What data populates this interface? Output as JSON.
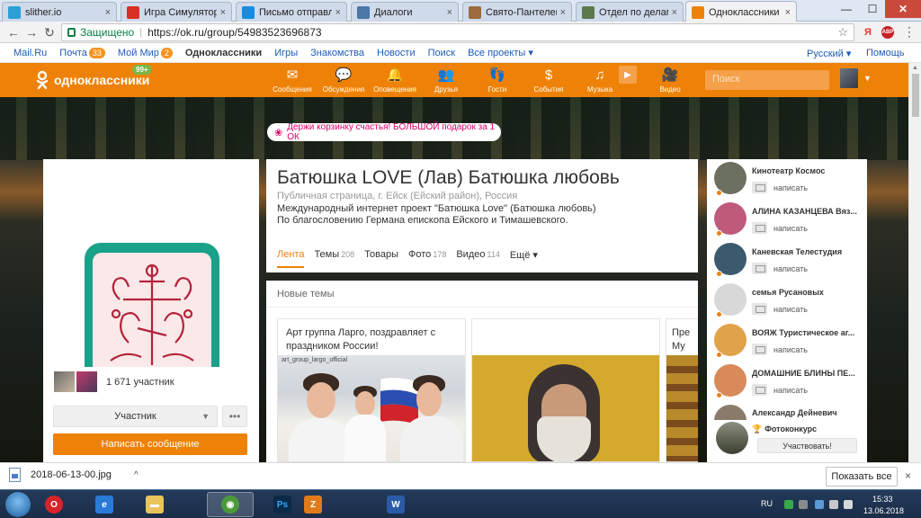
{
  "browser": {
    "tabs": [
      {
        "label": "slither.io",
        "icon": "slither-icon",
        "color": "#2b9fd6"
      },
      {
        "label": "Игра Симулятор",
        "icon": "chrome-icon",
        "color": "#d93025"
      },
      {
        "label": "Письмо отправлено",
        "icon": "mail-icon",
        "color": "#168de2"
      },
      {
        "label": "Диалоги",
        "icon": "vk-icon",
        "color": "#4a76a8"
      },
      {
        "label": "Свято-Пантелеимон",
        "icon": "page-icon",
        "color": "#9c6b3f"
      },
      {
        "label": "Отдел по делам мо",
        "icon": "page-icon",
        "color": "#5a7a4a"
      },
      {
        "label": "Одноклассники",
        "icon": "ok-icon",
        "color": "#ee8208"
      }
    ],
    "tab_close": "×",
    "win_min": "—",
    "win_max": "☐",
    "win_close": "✕",
    "back": "←",
    "forward": "→",
    "reload": "↻",
    "secure_label": "Защищено",
    "url_sep": "|",
    "url": "https://ok.ru/group/54983523696873",
    "star": "☆",
    "ext_yandex": "Я",
    "ext_abp": "ABP",
    "menu": "⋮"
  },
  "mailru": {
    "links": [
      {
        "label": "Mail.Ru"
      },
      {
        "label": "Почта",
        "badge": "33"
      },
      {
        "label": "Мой Мир",
        "badge": "2"
      },
      {
        "label": "Одноклассники",
        "bold": true
      },
      {
        "label": "Игры"
      },
      {
        "label": "Знакомства"
      },
      {
        "label": "Новости"
      },
      {
        "label": "Поиск"
      },
      {
        "label": "Все проекты ▾"
      }
    ],
    "lang": "Русский ▾",
    "help": "Помощь"
  },
  "ok": {
    "logo_text": "одноклассники",
    "badge": "99+",
    "nav": [
      {
        "label": "Сообщения",
        "glyph": "✉"
      },
      {
        "label": "Обсуждения",
        "glyph": "💬"
      },
      {
        "label": "Оповещения",
        "glyph": "🔔"
      },
      {
        "label": "Друзья",
        "glyph": "👥"
      },
      {
        "label": "Гости",
        "glyph": "👣"
      },
      {
        "label": "События",
        "glyph": "$"
      },
      {
        "label": "Музыка",
        "glyph": "♫"
      },
      {
        "label": "",
        "glyph": "▶"
      },
      {
        "label": "Видео",
        "glyph": "🎥"
      }
    ],
    "search_placeholder": "Поиск",
    "avatar_caret": "▼"
  },
  "promo": {
    "icon": "❀",
    "text": "Держи корзинку счастья! БОЛЬШОЙ подарок за 1 ОК"
  },
  "group": {
    "title": "Батюшка LOVE (Лав) Батюшка любовь",
    "subtitle": "Публичная страница, г. Ейск (Ейский район), Россия",
    "desc1": "Международный интернет проект \"Батюшка Love\" (Батюшка любовь)",
    "desc2": "По благословению Германа епископа Ейского и Тимашевского.",
    "tabs": [
      {
        "label": "Лента",
        "count": ""
      },
      {
        "label": "Темы",
        "count": "208"
      },
      {
        "label": "Товары",
        "count": ""
      },
      {
        "label": "Фото",
        "count": "178"
      },
      {
        "label": "Видео",
        "count": "114"
      },
      {
        "label": "Ещё ▾",
        "count": ""
      }
    ],
    "members_count": "1 671 участник",
    "member_btn": "Участник",
    "member_caret": "▼",
    "more_btn": "•••",
    "write_btn": "Написать сообщение"
  },
  "topics": {
    "title": "Новые темы",
    "cards": [
      {
        "text": "Арт группа Ларго, поздравляет с праздником России!",
        "watermark": "art_group_largo_official"
      },
      {
        "text": ""
      },
      {
        "text": "Пре\nМу"
      }
    ]
  },
  "friends": {
    "msg_label": "написать",
    "list": [
      {
        "name": "Кинотеатр Космос",
        "avatar": "#6b7060"
      },
      {
        "name": "АЛИНА КАЗАНЦЕВА Вяз...",
        "avatar": "#c05a7a"
      },
      {
        "name": "Каневская Телестудия",
        "avatar": "#3c5a6e"
      },
      {
        "name": "семья Русановых",
        "avatar": "#d8d8d8"
      },
      {
        "name": "ВОЯЖ Туристическое аг...",
        "avatar": "#e0a24a"
      },
      {
        "name": "ДОМАШНИЕ БЛИНЫ ПЕ...",
        "avatar": "#d98a5a"
      },
      {
        "name": "Александр Дейневич",
        "avatar": "#8a7a6a"
      }
    ],
    "contest_title": "Фотоконкурс",
    "contest_icon": "🏆",
    "contest_btn": "Участвовать!"
  },
  "downloads": {
    "file": "2018-06-13-00.jpg",
    "caret": "^",
    "show_all": "Показать все",
    "close": "×"
  },
  "taskbar": {
    "apps": [
      {
        "name": "ie",
        "color": "#2a7ad8",
        "glyph": "e"
      },
      {
        "name": "opera",
        "color": "#d8232a",
        "glyph": "O"
      },
      {
        "name": "explorer",
        "color": "#e8c45a",
        "glyph": "▬"
      },
      {
        "name": "chrome",
        "color": "#4a9a3a",
        "glyph": "◉"
      },
      {
        "name": "photoshop",
        "color": "#0b2a4a",
        "glyph": "Ps"
      },
      {
        "name": "app",
        "color": "#e07a1a",
        "glyph": "Z"
      },
      {
        "name": "word",
        "color": "#2a5aa8",
        "glyph": "W"
      }
    ],
    "lang": "RU",
    "time": "15:33",
    "date": "13.06.2018"
  }
}
